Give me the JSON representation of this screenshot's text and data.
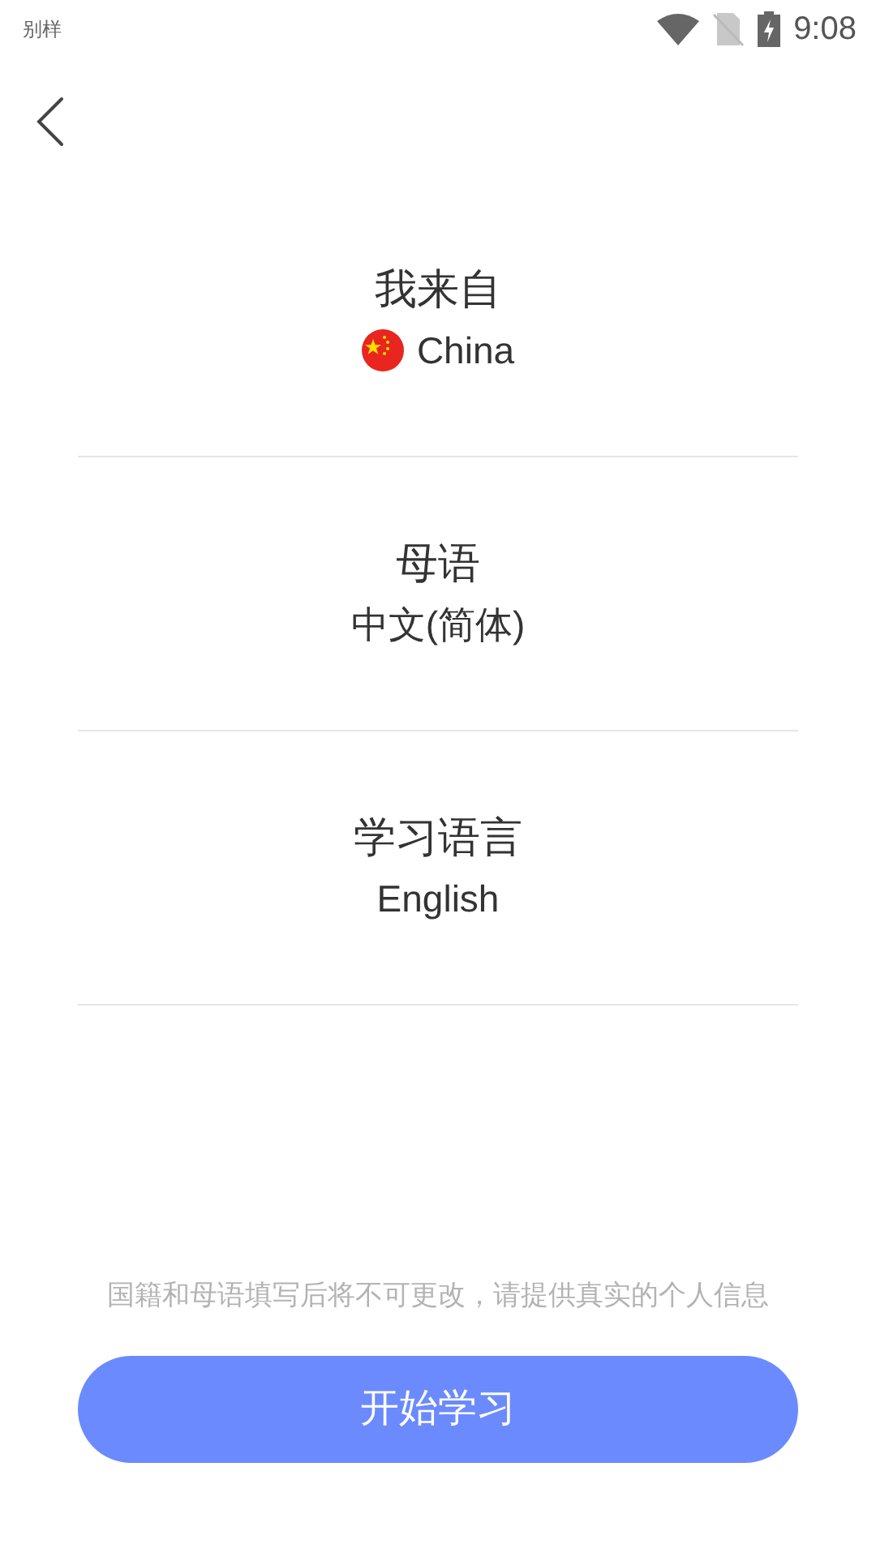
{
  "status_bar": {
    "carrier": "别样",
    "time": "9:08"
  },
  "fields": [
    {
      "label": "我来自",
      "value": "China",
      "kind": "country"
    },
    {
      "label": "母语",
      "value": "中文(简体)",
      "kind": "language"
    },
    {
      "label": "学习语言",
      "value": "English",
      "kind": "language"
    }
  ],
  "notice": "国籍和母语填写后将不可更改，请提供真实的个人信息",
  "start_button": "开始学习"
}
